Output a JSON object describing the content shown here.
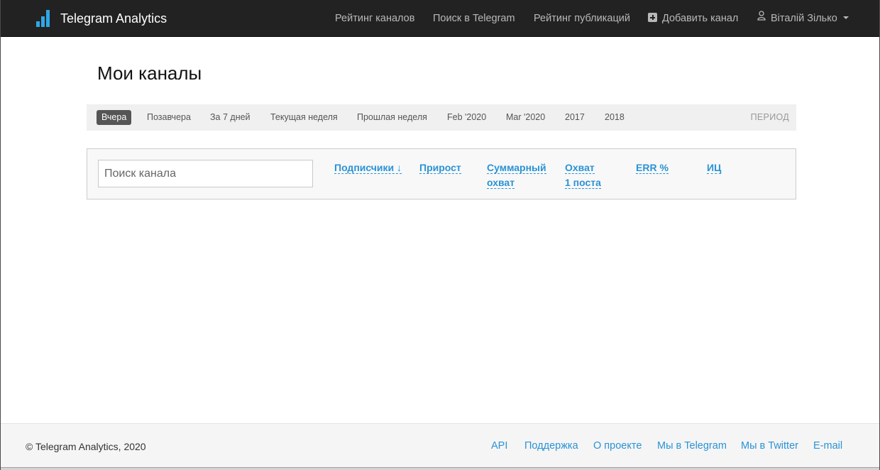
{
  "navbar": {
    "brand": "Telegram Analytics",
    "links": [
      {
        "label": "Рейтинг каналов"
      },
      {
        "label": "Поиск в Telegram"
      },
      {
        "label": "Рейтинг публикаций"
      },
      {
        "label": "Добавить канал",
        "icon": "plus-square-icon"
      },
      {
        "label": "Віталій Зілько",
        "icon": "user-icon"
      }
    ]
  },
  "page": {
    "title": "Мои каналы"
  },
  "periods": {
    "items": [
      "Вчера",
      "Позавчера",
      "За 7 дней",
      "Текущая неделя",
      "Прошлая неделя",
      "Feb '2020",
      "Mar '2020",
      "2017",
      "2018"
    ],
    "active": "Вчера",
    "label": "ПЕРИОД"
  },
  "filters": {
    "search_placeholder": "Поиск канала",
    "columns": [
      {
        "line1": "Подписчики ↓",
        "line2": ""
      },
      {
        "line1": "Прирост",
        "line2": ""
      },
      {
        "line1": "Суммарный",
        "line2": "охват"
      },
      {
        "line1": "Охват",
        "line2": "1 поста"
      },
      {
        "line1": "ERR %",
        "line2": ""
      },
      {
        "line1": "ИЦ",
        "line2": ""
      }
    ]
  },
  "footer": {
    "copyright": "© Telegram Analytics, 2020",
    "links": [
      "API",
      "Поддержка",
      "О проекте",
      "Мы в Telegram",
      "Мы в Twitter",
      "E-mail"
    ]
  },
  "colors": {
    "navbar_bg": "#222222",
    "accent_blue": "#2a93d5",
    "logo_blue": "#2ea7e6",
    "active_period": "#555555"
  }
}
